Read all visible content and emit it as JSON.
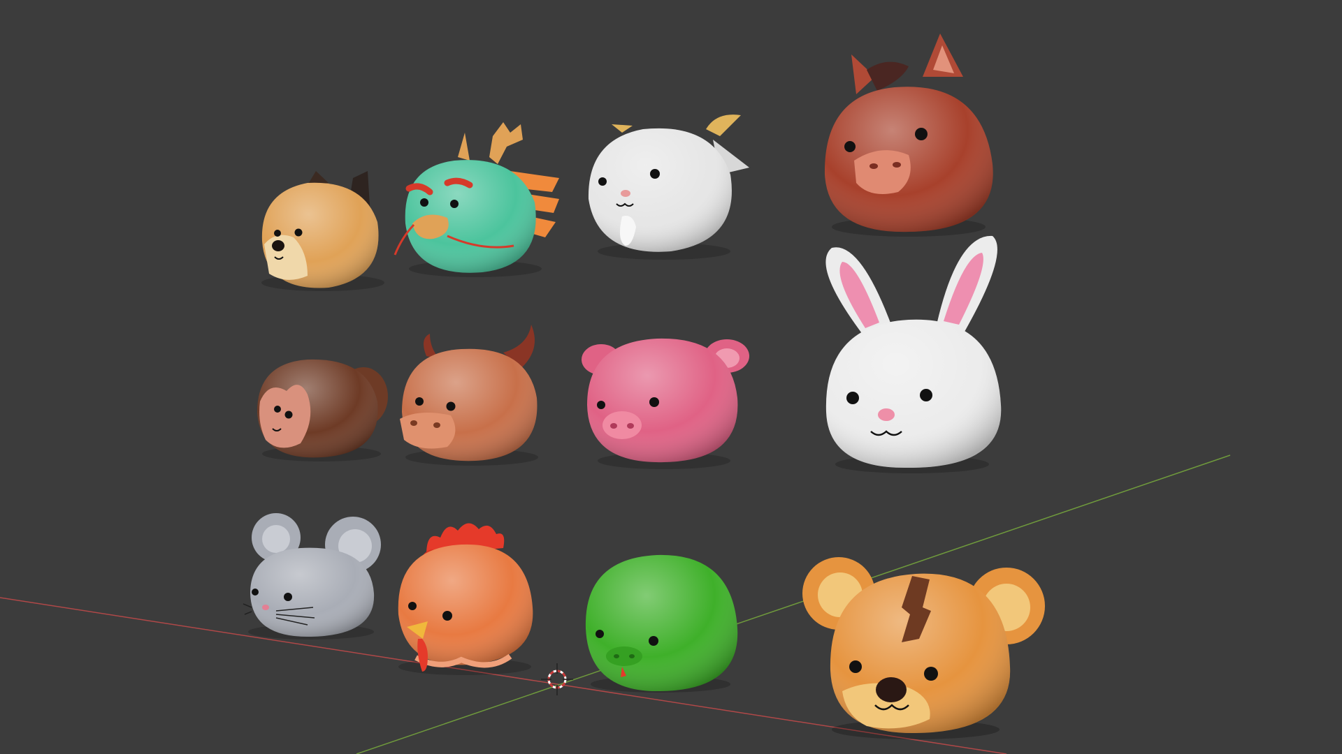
{
  "viewport": {
    "background": "#3c3c3c",
    "x_axis_color": "#b04848",
    "y_axis_color": "#6f9a3c",
    "cursor_icon": "3d-cursor-icon"
  },
  "models": [
    {
      "name": "dog",
      "icon": "dog-head-icon",
      "color": "#e0a257"
    },
    {
      "name": "dragon",
      "icon": "dragon-head-icon",
      "color": "#4cc49d"
    },
    {
      "name": "goat",
      "icon": "goat-head-icon",
      "color": "#e6e6e6"
    },
    {
      "name": "horse",
      "icon": "horse-head-icon",
      "color": "#a8412c"
    },
    {
      "name": "monkey",
      "icon": "monkey-head-icon",
      "color": "#6e3b26"
    },
    {
      "name": "ox",
      "icon": "ox-head-icon",
      "color": "#c8704a"
    },
    {
      "name": "pig",
      "icon": "pig-head-icon",
      "color": "#e06285"
    },
    {
      "name": "rabbit",
      "icon": "rabbit-head-icon",
      "color": "#ececec"
    },
    {
      "name": "rat",
      "icon": "rat-head-icon",
      "color": "#a9adb6"
    },
    {
      "name": "rooster",
      "icon": "rooster-head-icon",
      "color": "#e87a42"
    },
    {
      "name": "snake",
      "icon": "snake-head-icon",
      "color": "#3fb02a"
    },
    {
      "name": "tiger",
      "icon": "tiger-head-icon",
      "color": "#e6943f"
    }
  ]
}
